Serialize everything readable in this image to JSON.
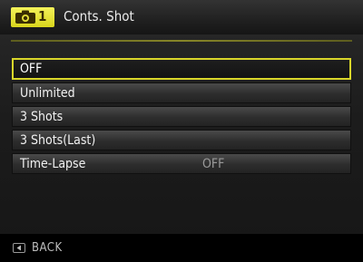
{
  "header": {
    "tab_number": "1",
    "title": "Conts. Shot",
    "icon": "camera-icon"
  },
  "menu": {
    "items": [
      {
        "label": "OFF",
        "value": "",
        "selected": true
      },
      {
        "label": "Unlimited",
        "value": ""
      },
      {
        "label": "3 Shots",
        "value": ""
      },
      {
        "label": "3 Shots(Last)",
        "value": ""
      },
      {
        "label": "Time-Lapse",
        "value": "OFF"
      }
    ]
  },
  "footer": {
    "back_label": "BACK",
    "back_icon": "left-arrow-key-icon"
  },
  "colors": {
    "accent": "#d9d62a",
    "background": "#1c1c1c"
  }
}
